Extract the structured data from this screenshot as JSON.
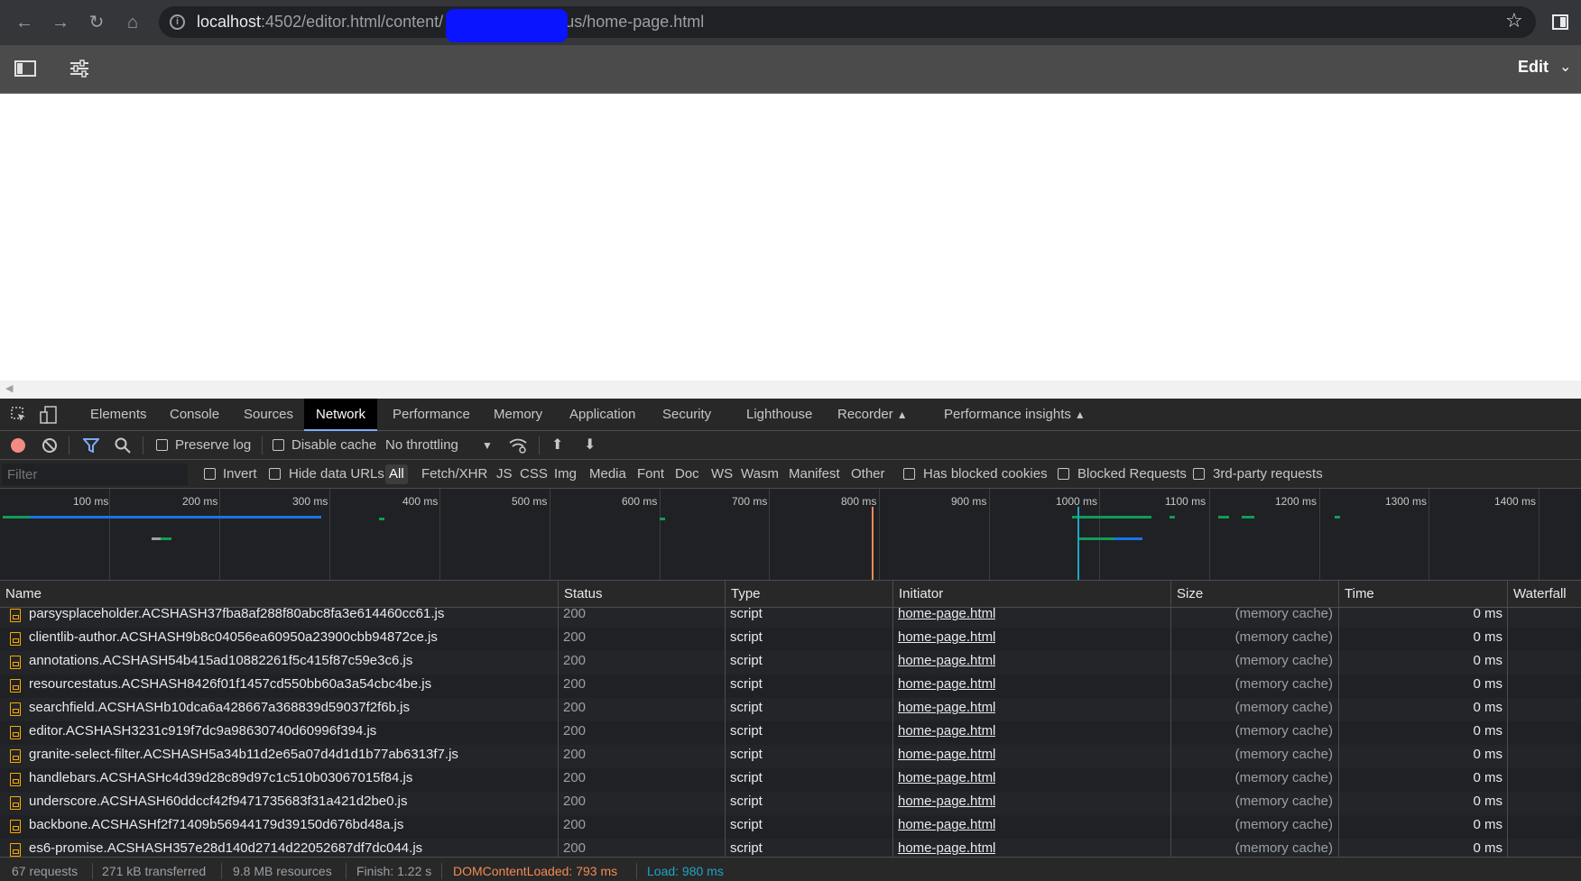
{
  "browser": {
    "url_host": "localhost",
    "url_path_prefix": ":4502/editor.html/content/",
    "url_path_suffix": "us/home-page.html"
  },
  "editor": {
    "mode_label": "Edit"
  },
  "devtools": {
    "tabs": [
      "Elements",
      "Console",
      "Sources",
      "Network",
      "Performance",
      "Memory",
      "Application",
      "Security",
      "Lighthouse",
      "Recorder",
      "Performance insights"
    ],
    "active_tab": "Network",
    "toolbar": {
      "preserve_log": "Preserve log",
      "disable_cache": "Disable cache",
      "throttling": "No throttling"
    },
    "filter": {
      "placeholder": "Filter",
      "invert": "Invert",
      "hide_data_urls": "Hide data URLs",
      "types": [
        "All",
        "Fetch/XHR",
        "JS",
        "CSS",
        "Img",
        "Media",
        "Font",
        "Doc",
        "WS",
        "Wasm",
        "Manifest",
        "Other"
      ],
      "active_type": "All",
      "has_blocked_cookies": "Has blocked cookies",
      "blocked_requests": "Blocked Requests",
      "third_party": "3rd-party requests"
    },
    "overview_ticks": [
      "100 ms",
      "200 ms",
      "300 ms",
      "400 ms",
      "500 ms",
      "600 ms",
      "700 ms",
      "800 ms",
      "900 ms",
      "1000 ms",
      "1100 ms",
      "1200 ms",
      "1300 ms",
      "1400 ms"
    ],
    "columns": {
      "name": "Name",
      "status": "Status",
      "type": "Type",
      "initiator": "Initiator",
      "size": "Size",
      "time": "Time",
      "waterfall": "Waterfall"
    },
    "requests": [
      {
        "name": "parsysplaceholder.ACSHASH37fba8af288f80abc8fa3e614460cc61.js",
        "status": "200",
        "type": "script",
        "initiator": "home-page.html",
        "size": "(memory cache)",
        "time": "0 ms"
      },
      {
        "name": "clientlib-author.ACSHASH9b8c04056ea60950a23900cbb94872ce.js",
        "status": "200",
        "type": "script",
        "initiator": "home-page.html",
        "size": "(memory cache)",
        "time": "0 ms"
      },
      {
        "name": "annotations.ACSHASH54b415ad10882261f5c415f87c59e3c6.js",
        "status": "200",
        "type": "script",
        "initiator": "home-page.html",
        "size": "(memory cache)",
        "time": "0 ms"
      },
      {
        "name": "resourcestatus.ACSHASH8426f01f1457cd550bb60a3a54cbc4be.js",
        "status": "200",
        "type": "script",
        "initiator": "home-page.html",
        "size": "(memory cache)",
        "time": "0 ms"
      },
      {
        "name": "searchfield.ACSHASHb10dca6a428667a368839d59037f2f6b.js",
        "status": "200",
        "type": "script",
        "initiator": "home-page.html",
        "size": "(memory cache)",
        "time": "0 ms"
      },
      {
        "name": "editor.ACSHASH3231c919f7dc9a98630740d60996f394.js",
        "status": "200",
        "type": "script",
        "initiator": "home-page.html",
        "size": "(memory cache)",
        "time": "0 ms"
      },
      {
        "name": "granite-select-filter.ACSHASH5a34b11d2e65a07d4d1d1b77ab6313f7.js",
        "status": "200",
        "type": "script",
        "initiator": "home-page.html",
        "size": "(memory cache)",
        "time": "0 ms"
      },
      {
        "name": "handlebars.ACSHASHc4d39d28c89d97c1c510b03067015f84.js",
        "status": "200",
        "type": "script",
        "initiator": "home-page.html",
        "size": "(memory cache)",
        "time": "0 ms"
      },
      {
        "name": "underscore.ACSHASH60ddccf42f9471735683f31a421d2be0.js",
        "status": "200",
        "type": "script",
        "initiator": "home-page.html",
        "size": "(memory cache)",
        "time": "0 ms"
      },
      {
        "name": "backbone.ACSHASHf2f71409b56944179d39150d676bd48a.js",
        "status": "200",
        "type": "script",
        "initiator": "home-page.html",
        "size": "(memory cache)",
        "time": "0 ms"
      },
      {
        "name": "es6-promise.ACSHASH357e28d140d2714d22052687df7dc044.js",
        "status": "200",
        "type": "script",
        "initiator": "home-page.html",
        "size": "(memory cache)",
        "time": "0 ms"
      }
    ],
    "summary": {
      "requests": "67 requests",
      "transferred": "271 kB transferred",
      "resources": "9.8 MB resources",
      "finish": "Finish: 1.22 s",
      "dom_content_loaded": "DOMContentLoaded: 793 ms",
      "load": "Load: 980 ms"
    }
  },
  "colors": {
    "dom_content_loaded": "#f28b54",
    "load": "#1ea5c6",
    "active_tab_underline": "#7cacf8",
    "record_button": "#f28b82"
  }
}
